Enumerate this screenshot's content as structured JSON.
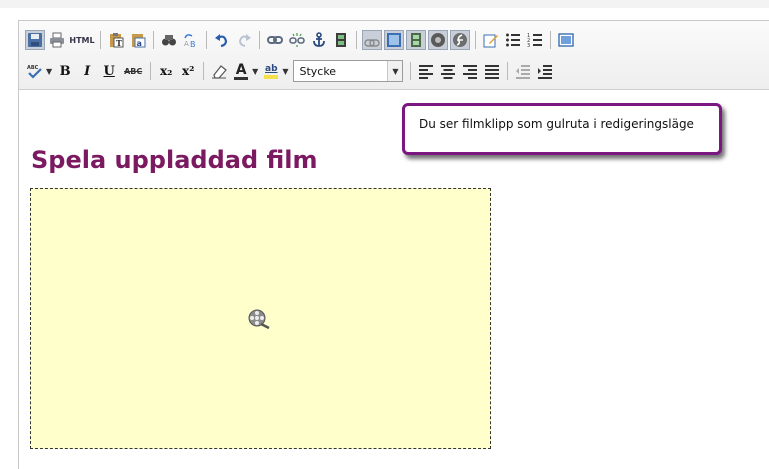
{
  "toolbar": {
    "row1": [
      {
        "name": "save-icon",
        "type": "icon"
      },
      {
        "name": "print-icon",
        "type": "icon"
      },
      {
        "name": "html-source-button",
        "type": "text"
      },
      {
        "name": "sep",
        "type": "sep"
      },
      {
        "name": "paste-text-icon",
        "type": "icon"
      },
      {
        "name": "paste-word-icon",
        "type": "icon"
      },
      {
        "name": "sep",
        "type": "sep"
      },
      {
        "name": "find-icon",
        "type": "icon"
      },
      {
        "name": "replace-icon",
        "type": "icon"
      },
      {
        "name": "sep",
        "type": "sep"
      },
      {
        "name": "undo-icon",
        "type": "icon"
      },
      {
        "name": "redo-icon",
        "type": "icon"
      },
      {
        "name": "sep",
        "type": "sep"
      },
      {
        "name": "link-icon",
        "type": "icon"
      },
      {
        "name": "unlink-icon",
        "type": "icon"
      },
      {
        "name": "anchor-icon",
        "type": "icon"
      },
      {
        "name": "media-icon",
        "type": "icon"
      },
      {
        "name": "sep",
        "type": "sep"
      },
      {
        "name": "image-icon",
        "type": "icon",
        "active": true
      },
      {
        "name": "image-insert-icon",
        "type": "icon",
        "active": true
      },
      {
        "name": "movie-icon",
        "type": "icon",
        "active": true
      },
      {
        "name": "quicktime-icon",
        "type": "icon",
        "active": true
      },
      {
        "name": "flash-icon",
        "type": "icon",
        "active": true
      },
      {
        "name": "sep",
        "type": "sep"
      },
      {
        "name": "edit-icon",
        "type": "icon"
      },
      {
        "name": "bullet-list-icon",
        "type": "icon"
      },
      {
        "name": "numbered-list-icon",
        "type": "icon"
      },
      {
        "name": "sep",
        "type": "sep"
      },
      {
        "name": "fullscreen-icon",
        "type": "icon"
      }
    ],
    "html_label": "HTML",
    "bold_label": "B",
    "italic_label": "I",
    "underline_label": "U",
    "strike_label": "ABC",
    "subscript_label": "x₂",
    "superscript_label": "x²",
    "font_color_label": "A",
    "highlight_label": "ab",
    "format_select": "Stycke",
    "colors": {
      "accent": "#7b1a60",
      "tooltip_border": "#7a1781",
      "movie_bg": "#ffffcc"
    }
  },
  "content": {
    "heading": "Spela uppladdad film"
  },
  "tooltip": {
    "text": "Du ser filmklipp som gulruta i redigeringsläge"
  }
}
